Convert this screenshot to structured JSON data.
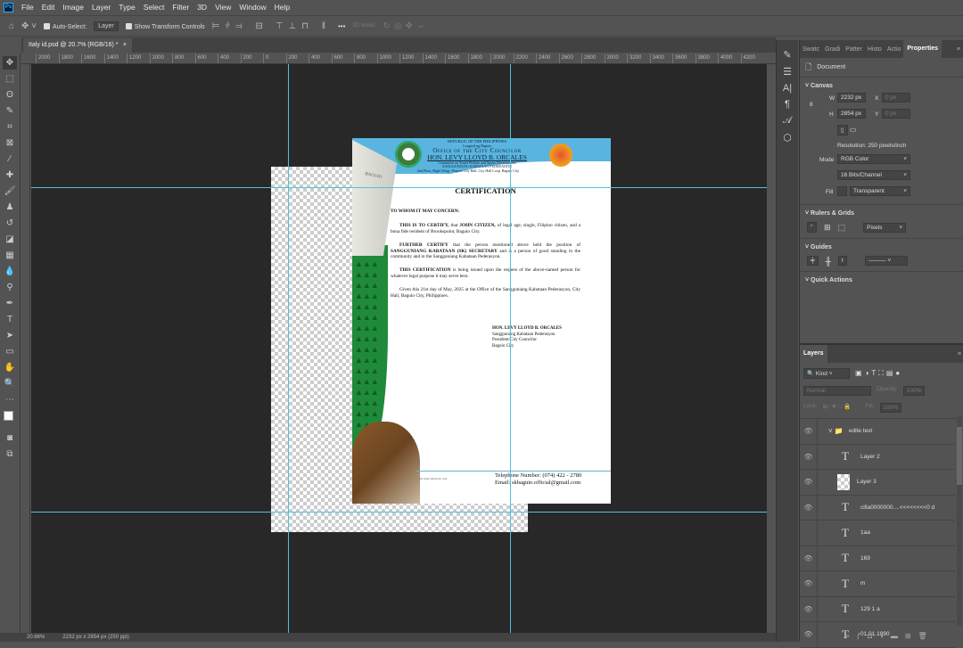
{
  "menu": {
    "logo": "Ps",
    "items": [
      "File",
      "Edit",
      "Image",
      "Layer",
      "Type",
      "Select",
      "Filter",
      "3D",
      "View",
      "Window",
      "Help"
    ]
  },
  "options": {
    "auto_select_label": "Auto-Select:",
    "auto_select_value": "Layer",
    "show_transform_label": "Show Transform Controls",
    "more": "•••",
    "mode_3d": "3D Mode:"
  },
  "tab": {
    "title": "Italy id.psd @ 20.7% (RGB/16) *",
    "close": "×"
  },
  "ruler": [
    "2000",
    "1800",
    "1600",
    "1400",
    "1200",
    "1000",
    "800",
    "600",
    "400",
    "200",
    "0",
    "200",
    "400",
    "600",
    "800",
    "1000",
    "1200",
    "1400",
    "1600",
    "1800",
    "2000",
    "2200",
    "2400",
    "2600",
    "2800",
    "3000",
    "3200",
    "3400",
    "3600",
    "3800",
    "4000",
    "4200"
  ],
  "document": {
    "header": {
      "line1": "REPUBLIC OF THE PHILIPPINES",
      "line2": "Lungsod ng Baguio",
      "line3": "Office of the City Councilor",
      "line4": "HON. LEVY LLOYD B. ORCALES",
      "line5": "Committee on Youth Welfare and Sports Development",
      "line6": "SANGGUNIANG KABATAAN FEDERATION",
      "line7": "2nd Floor, Right Wing - Baguio City Hall, City Hall Loop, Baguio City"
    },
    "building_sign": "BAGUIO",
    "title": "CERTIFICATION",
    "salutation": "TO WHOM IT MAY CONCERN:",
    "p1_bold": "THIS IS TO CERTIFY,",
    "p1_a": " that ",
    "p1_name": "JOHN CITIZEN,",
    "p1_b": " of legal age, single, Filipino citizen, and a bona fide resident of Brookspoint, Baguio City.",
    "p2_bold": "FURTHER CERTIFY",
    "p2_a": " that the person mentioned above held the position of ",
    "p2_pos": "SANGGUNIANG KABATAAN (SK) SECRETARY",
    "p2_b": " and is a person of good standing in the community and in the Sangguniang Kabataan Pederasyon.",
    "p3_bold": "THIS CERTIFICATION",
    "p3_a": " is being issued upon the request of the above-named person for whatever legal purpose it may serve best.",
    "p4": "Given this 21st day of May, 2025 at the Office of the Sangguniang Kabataan Pederasyon, City Hall, Baguio City, Philippines.",
    "sig_name": "HON. LEVY LLOYD B. ORCALES",
    "sig_l1": "Sangguniang Kabataan Pederasyon",
    "sig_l2": "President/City Councilor",
    "sig_l3": "Baguio City",
    "seal_note": "Not valid without dry seal",
    "telephone": "Telephone Number: (074) 422 - 2780",
    "email": "Email: skbaguio.official@gmail.com"
  },
  "status": {
    "zoom": "20.66%",
    "size": "2232 px x 2854 px (250 ppi)"
  },
  "properties": {
    "tabs": [
      "Swatc",
      "Gradi",
      "Patter",
      "Histo",
      "Actio",
      "Properties"
    ],
    "doc_label": "Document",
    "canvas_title": "Canvas",
    "w_label": "W",
    "w": "2232 px",
    "h_label": "H",
    "h": "2854 px",
    "x_label": "X",
    "x": "0 px",
    "y_label": "Y",
    "y": "0 px",
    "resolution": "Resolution: 250 pixels/inch",
    "mode_label": "Mode",
    "mode": "RGB Color",
    "depth": "16 Bits/Channel",
    "fill_label": "Fill",
    "fill": "Transparent",
    "rulers_title": "Rulers & Grids",
    "units": "Pixels",
    "guides_title": "Guides",
    "quick_title": "Quick Actions"
  },
  "layers": {
    "title": "Layers",
    "kind": "Kind",
    "blend": "Normal",
    "opacity_label": "Opacity:",
    "opacity": "100%",
    "lock_label": "Lock:",
    "fill_label": "Fill:",
    "fill": "100%",
    "items": [
      {
        "name": "edite text",
        "type": "group",
        "visible": true
      },
      {
        "name": "Layer 2",
        "type": "text",
        "visible": true
      },
      {
        "name": "Layer 3",
        "type": "pixel",
        "visible": true
      },
      {
        "name": "cilla0000000....<<<<<<<<0 d",
        "type": "text",
        "visible": true
      },
      {
        "name": "1aa",
        "type": "text",
        "visible": false
      },
      {
        "name": "169",
        "type": "text",
        "visible": true
      },
      {
        "name": "m",
        "type": "text",
        "visible": true
      },
      {
        "name": "129 1 a",
        "type": "text",
        "visible": true
      },
      {
        "name": "01.01.1990",
        "type": "text",
        "visible": true
      }
    ]
  },
  "colors": {
    "accent": "#31a8ff",
    "guide": "#4fc3d9",
    "green": "#1e8a3a",
    "sky": "#5ab4e0"
  }
}
